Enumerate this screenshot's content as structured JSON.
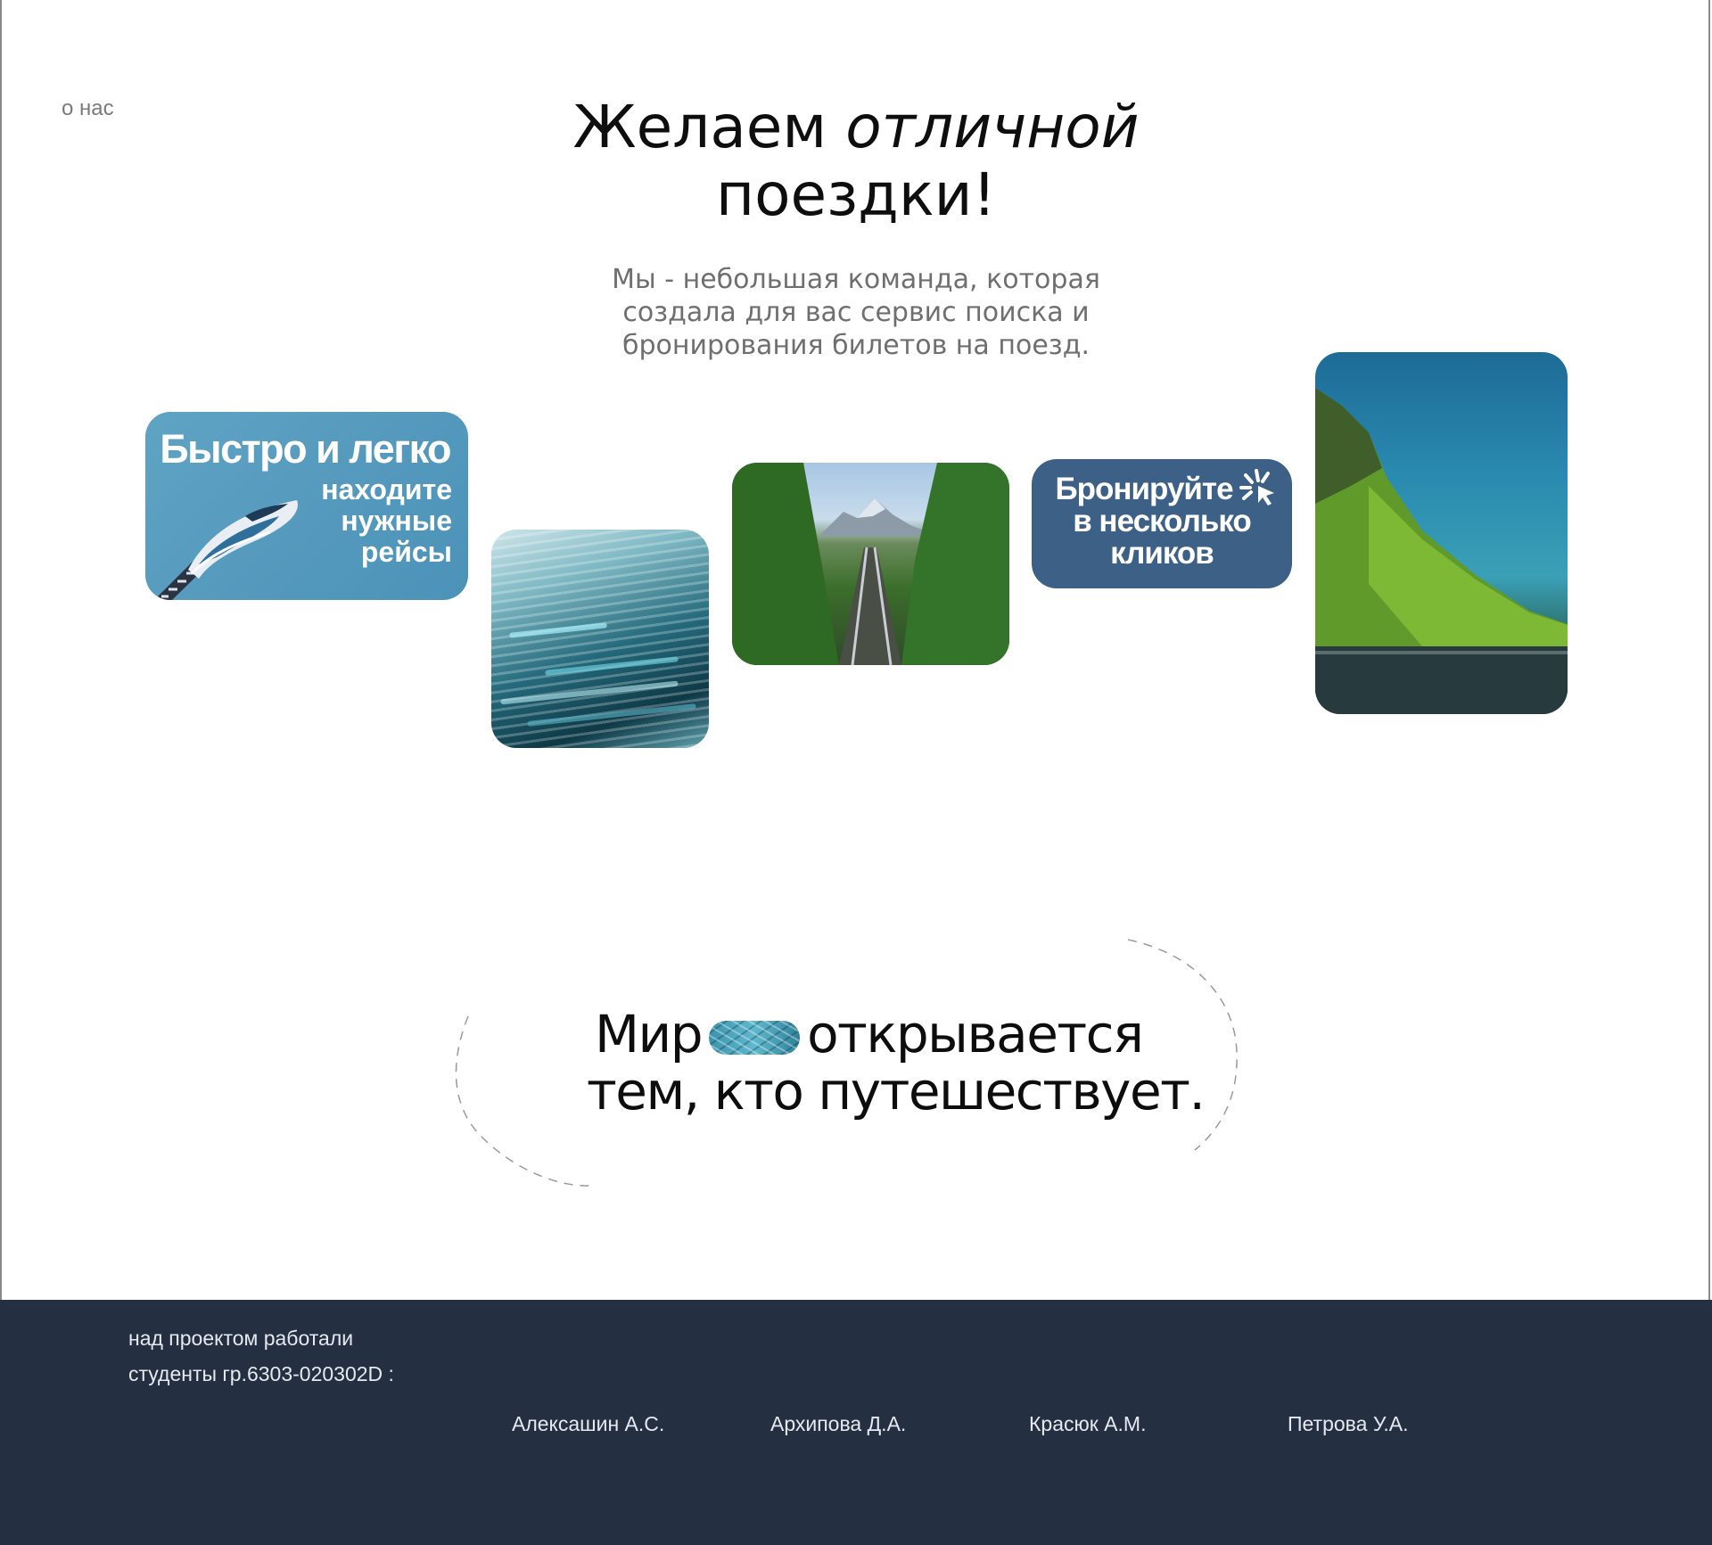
{
  "nav": {
    "about_label": "о нас"
  },
  "hero": {
    "title_part1": "Желаем ",
    "title_italic": "отличной",
    "title_part2": "поездки!",
    "subtitle": "Мы - небольшая команда, которая создала для вас сервис поиска и бронирования билетов на поезд."
  },
  "cards": {
    "fast": {
      "heading": "Быстро и легко",
      "line1": "находите",
      "line2": "нужные",
      "line3": "рейсы"
    },
    "book": {
      "line1": "Бронируйте",
      "line2": "в несколько",
      "line3": "кликов"
    }
  },
  "world": {
    "word1": "Мир",
    "word2": "открывается",
    "line2": "тем, кто путешествует."
  },
  "footer": {
    "credits_line1": "над проектом работали",
    "credits_line2": "студенты гр.6303-020302D :",
    "authors": [
      "Алексашин А.С.",
      "Архипова Д.А.",
      "Красюк А.М.",
      "Петрова У.А."
    ]
  },
  "colors": {
    "footer_bg": "#242f42",
    "card_fast_bg": "#5fa3c4",
    "card_book_bg": "#3d6186"
  }
}
